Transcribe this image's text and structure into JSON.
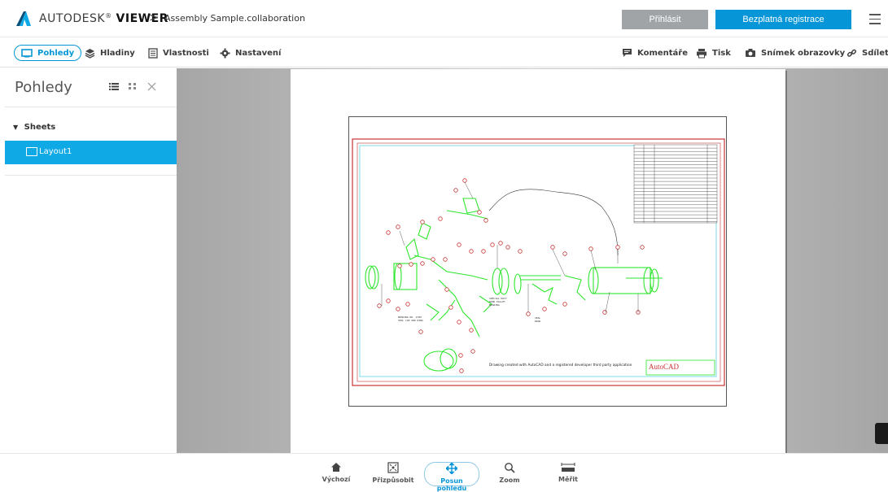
{
  "header": {
    "brand_prefix": "AUTODESK",
    "brand_suffix": "VIEWER",
    "breadcrumb_sep": ">",
    "document_name": "Assembly Sample.collaboration",
    "login_label": "Přihlásit",
    "register_label": "Bezplatná registrace"
  },
  "toolbar": {
    "left": [
      {
        "label": "Pohledy",
        "icon": "views-icon",
        "active": true
      },
      {
        "label": "Hladiny",
        "icon": "layers-icon"
      },
      {
        "label": "Vlastnosti",
        "icon": "properties-icon"
      },
      {
        "label": "Nastavení",
        "icon": "gear-icon"
      }
    ],
    "right": [
      {
        "label": "Komentáře",
        "icon": "comment-icon"
      },
      {
        "label": "Tisk",
        "icon": "print-icon"
      },
      {
        "label": "Snímek obrazovky",
        "icon": "camera-icon"
      },
      {
        "label": "Sdílet",
        "icon": "link-icon"
      }
    ]
  },
  "sidebar": {
    "title": "Pohledy",
    "group_label": "Sheets",
    "items": [
      {
        "label": "Layout1",
        "selected": true
      }
    ]
  },
  "drawing": {
    "note": "Drawing created with AutoCAD and a registered developer third party application",
    "stamp": "AutoCAD"
  },
  "bottom_toolbar": [
    {
      "label": "Výchozí",
      "icon": "home-icon"
    },
    {
      "label": "Přizpůsobit",
      "icon": "fit-icon"
    },
    {
      "label": "Posun pohledu",
      "icon": "pan-icon",
      "active": true
    },
    {
      "label": "Zoom",
      "icon": "zoom-icon"
    },
    {
      "label": "Měřit",
      "icon": "measure-icon"
    }
  ],
  "colors": {
    "accent": "#0696d7",
    "selected_row": "#0fa9e6",
    "login_button": "#a0a4a7",
    "drawing_green": "#2ee62e",
    "drawing_red": "#c83232",
    "drawing_cyan": "#5fd3e6"
  }
}
